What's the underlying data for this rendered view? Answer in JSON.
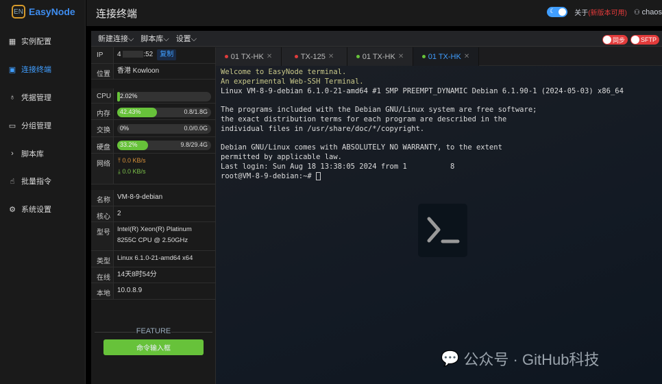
{
  "app": {
    "logo_mark": "EN",
    "name": "EasyNode"
  },
  "sidebar": {
    "items": [
      {
        "label": "实例配置",
        "icon": "grid-icon"
      },
      {
        "label": "连接终端",
        "icon": "terminal-icon",
        "active": true
      },
      {
        "label": "凭据管理",
        "icon": "key-icon"
      },
      {
        "label": "分组管理",
        "icon": "folder-icon"
      },
      {
        "label": "脚本库",
        "icon": "chevron-right-icon"
      },
      {
        "label": "批量指令",
        "icon": "pointer-hand-icon"
      },
      {
        "label": "系统设置",
        "icon": "gear-icon"
      }
    ]
  },
  "header": {
    "title": "连接终端",
    "about": "关于",
    "update": "(新版本可用)",
    "user": "chaos",
    "dark_mode": true
  },
  "toolbar": {
    "menus": [
      "新建连接",
      "脚本库",
      "设置"
    ],
    "sync": "同步",
    "sftp": "SFTP"
  },
  "info": {
    "ip_label": "IP",
    "ip_prefix": "4",
    "ip_suffix": ":52",
    "copy": "复制",
    "loc_label": "位置",
    "loc": "香港 Kowloon",
    "cpu_label": "CPU",
    "cpu": "2.02%",
    "cpu_pct": 2.02,
    "mem_label": "内存",
    "mem": "42.43%",
    "mem_pct": 42.43,
    "mem_used": "0.8/1.8G",
    "swap_label": "交换",
    "swap": "0%",
    "swap_pct": 0,
    "swap_used": "0.0/0.0G",
    "disk_label": "硬盘",
    "disk": "33.2%",
    "disk_pct": 33.2,
    "disk_used": "9.8/29.4G",
    "net_label": "网络",
    "up": "0.0 KB/s",
    "down": "0.0 KB/s",
    "name_label": "名称",
    "name": "VM-8-9-debian",
    "cores_label": "核心",
    "cores": "2",
    "model_label": "型号",
    "model": "Intel(R) Xeon(R) Platinum 8255C CPU @ 2.50GHz",
    "type_label": "类型",
    "type": "Linux 6.1.0-21-amd64 x64",
    "uptime_label": "在线",
    "uptime": "14天8时54分",
    "local_label": "本地",
    "local": "10.0.8.9",
    "feature": "FEATURE",
    "cmd_button": "命令输入框"
  },
  "tabs": [
    {
      "label": "01 TX-HK",
      "status": "#e03c3c"
    },
    {
      "label": "TX-125",
      "status": "#e03c3c"
    },
    {
      "label": "01 TX-HK",
      "status": "#67c23a"
    },
    {
      "label": "01 TX-HK",
      "status": "#67c23a",
      "active": true
    }
  ],
  "terminal": {
    "lines": [
      "Welcome to EasyNode terminal.",
      "An experimental Web-SSH Terminal.",
      "Linux VM-8-9-debian 6.1.0-21-amd64 #1 SMP PREEMPT_DYNAMIC Debian 6.1.90-1 (2024-05-03) x86_64",
      "",
      "The programs included with the Debian GNU/Linux system are free software;",
      "the exact distribution terms for each program are described in the",
      "individual files in /usr/share/doc/*/copyright.",
      "",
      "Debian GNU/Linux comes with ABSOLUTELY NO WARRANTY, to the extent",
      "permitted by applicable law.",
      "Last login: Sun Aug 18 13:38:05 2024 from 1          8",
      "root@VM-8-9-debian:~# "
    ]
  },
  "watermark": "公众号 · GitHub科技",
  "colors": {
    "accent": "#409eff",
    "success": "#67c23a",
    "danger": "#e23b3b"
  }
}
